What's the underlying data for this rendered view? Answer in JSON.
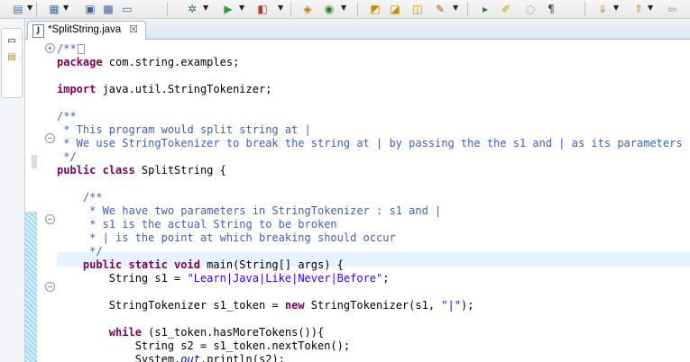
{
  "toolbar": {
    "buttons": [
      {
        "name": "new-icon",
        "glyph": "▤"
      },
      {
        "name": "new-wizard-icon",
        "glyph": "▦"
      },
      {
        "name": "save-icon",
        "glyph": "▣"
      },
      {
        "name": "save-all-icon",
        "glyph": "▩"
      },
      {
        "name": "print-icon",
        "glyph": "▭"
      },
      {
        "name": "debug-icon",
        "glyph": "✲"
      },
      {
        "name": "run-icon",
        "glyph": "▶"
      },
      {
        "name": "external-tools-icon",
        "glyph": "◧"
      },
      {
        "name": "new-java-project-icon",
        "glyph": "◈"
      },
      {
        "name": "new-class-icon",
        "glyph": "◉"
      },
      {
        "name": "open-type-icon",
        "glyph": "◩"
      },
      {
        "name": "open-task-icon",
        "glyph": "◪"
      },
      {
        "name": "search-folder-icon",
        "glyph": "◫"
      },
      {
        "name": "pen-icon",
        "glyph": "✎"
      },
      {
        "name": "skip-breakpoints-icon",
        "glyph": "▸"
      },
      {
        "name": "mark-occurrences-icon",
        "glyph": "✐"
      },
      {
        "name": "block-selection-icon",
        "glyph": "◌"
      },
      {
        "name": "show-whitespace-icon",
        "glyph": "¶"
      },
      {
        "name": "next-annotation-icon",
        "glyph": "⇓"
      },
      {
        "name": "previous-annotation-icon",
        "glyph": "⇑"
      },
      {
        "name": "back-icon",
        "glyph": "⇦"
      }
    ]
  },
  "editor": {
    "tab_label": "*SplitString.java",
    "tab_close": "☒",
    "tab_file_glyph": "J"
  },
  "code": {
    "l1": "/**",
    "l2_a": "package",
    "l2_b": " com.string.examples;",
    "l3_a": "import",
    "l3_b": " java.util.StringTokenizer;",
    "l4": "/**",
    "l5": " * This program would split string at |",
    "l6": " * We use StringTokenizer to break the string at | by passing the the s1 and | as its parameters",
    "l7": " */",
    "l8_a": "public class",
    "l8_b": " SplitString {",
    "l9": "    /**",
    "l10": "     * We have two parameters in StringTokenizer : s1 and |",
    "l11": "     * s1 is the actual String to be broken",
    "l12": "     * | is the point at which breaking should occur",
    "l13": "     */",
    "l14_a": "    public static void",
    "l14_b": " main(String[] args) {",
    "l15_a": "        String s1 = ",
    "l15_b": "\"Learn|Java|Like|Never|Before\"",
    "l15_c": ";",
    "l16_a": "        StringTokenizer s1_token = ",
    "l16_b": "new",
    "l16_c": " StringTokenizer(s1, ",
    "l16_d": "\"|\"",
    "l16_e": ");",
    "l17_a": "        while",
    "l17_b": " (s1_token.hasMoreTokens()){",
    "l18": "            String s2 = s1_token.nextToken();",
    "l19_a": "            System.",
    "l19_b": "out",
    "l19_c": ".println(s2);"
  },
  "colors": {
    "keyword": "#7f0055",
    "comment": "#3f5fbf",
    "string": "#2a00ff",
    "field": "#0000c0",
    "current_line": "#e8f2fe"
  }
}
